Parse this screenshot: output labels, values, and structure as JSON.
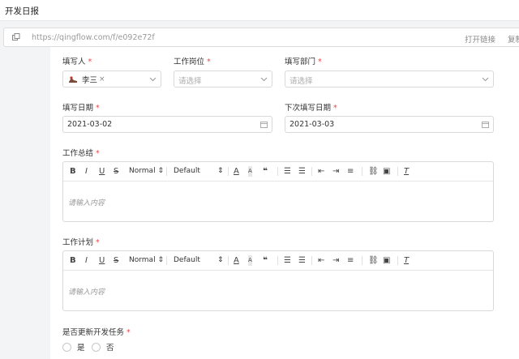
{
  "window": {
    "title": "开发日报"
  },
  "urlbar": {
    "url": "https://qingflow.com/f/e092e72f",
    "open_link": "打开链接",
    "copy": "复制"
  },
  "fields": {
    "filler": {
      "label": "填写人",
      "value": "李三"
    },
    "position": {
      "label": "工作岗位",
      "placeholder": "请选择"
    },
    "department": {
      "label": "填写部门",
      "placeholder": "请选择"
    },
    "date": {
      "label": "填写日期",
      "value": "2021-03-02"
    },
    "next_date": {
      "label": "下次填写日期",
      "value": "2021-03-03"
    }
  },
  "required_mark": "*",
  "toolbar": {
    "bold": "B",
    "italic": "I",
    "underline": "U",
    "strike": "S",
    "heading": "Normal",
    "font": "Default",
    "quote": "❝"
  },
  "editors": [
    {
      "label": "工作总结",
      "placeholder": "请输入内容"
    },
    {
      "label": "工作计划",
      "placeholder": "请输入内容"
    }
  ],
  "update_task": {
    "label": "是否更新开发任务",
    "options": [
      "是",
      "否"
    ]
  },
  "colors": {
    "required": "#e5484d",
    "border": "#d9d9d9"
  }
}
